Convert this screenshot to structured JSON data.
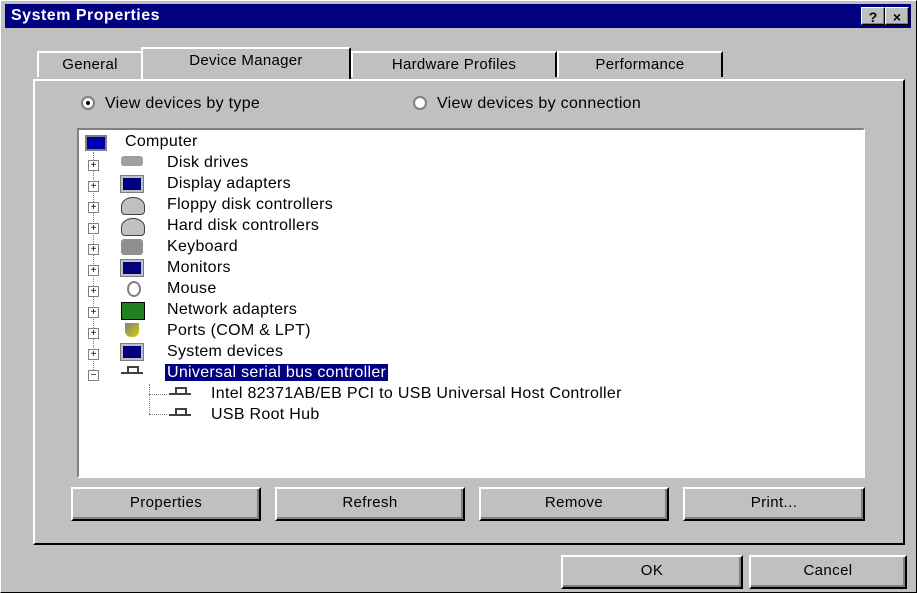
{
  "window": {
    "title": "System Properties",
    "help_label": "?",
    "close_label": "×"
  },
  "tabs": [
    {
      "label": "General"
    },
    {
      "label": "Device Manager"
    },
    {
      "label": "Hardware Profiles"
    },
    {
      "label": "Performance"
    }
  ],
  "view": {
    "by_type": "View devices by type",
    "by_connection": "View devices by connection",
    "selected": "by_type"
  },
  "tree": {
    "root": "Computer",
    "items": [
      {
        "label": "Disk drives",
        "icon": "disk-drive-icon"
      },
      {
        "label": "Display adapters",
        "icon": "display-adapter-icon"
      },
      {
        "label": "Floppy disk controllers",
        "icon": "floppy-controller-icon"
      },
      {
        "label": "Hard disk controllers",
        "icon": "hard-disk-controller-icon"
      },
      {
        "label": "Keyboard",
        "icon": "keyboard-icon"
      },
      {
        "label": "Monitors",
        "icon": "monitor-icon"
      },
      {
        "label": "Mouse",
        "icon": "mouse-icon"
      },
      {
        "label": "Network adapters",
        "icon": "network-adapter-icon"
      },
      {
        "label": "Ports (COM & LPT)",
        "icon": "port-icon"
      },
      {
        "label": "System devices",
        "icon": "system-devices-icon"
      },
      {
        "label": "Universal serial bus controller",
        "icon": "usb-icon",
        "selected": true,
        "expanded": true
      }
    ],
    "children": [
      {
        "label": "Intel 82371AB/EB PCI to USB Universal Host Controller",
        "icon": "usb-icon"
      },
      {
        "label": "USB Root Hub",
        "icon": "usb-icon"
      }
    ]
  },
  "buttons": {
    "properties": "Properties",
    "refresh": "Refresh",
    "remove": "Remove",
    "print": "Print...",
    "ok": "OK",
    "cancel": "Cancel"
  }
}
